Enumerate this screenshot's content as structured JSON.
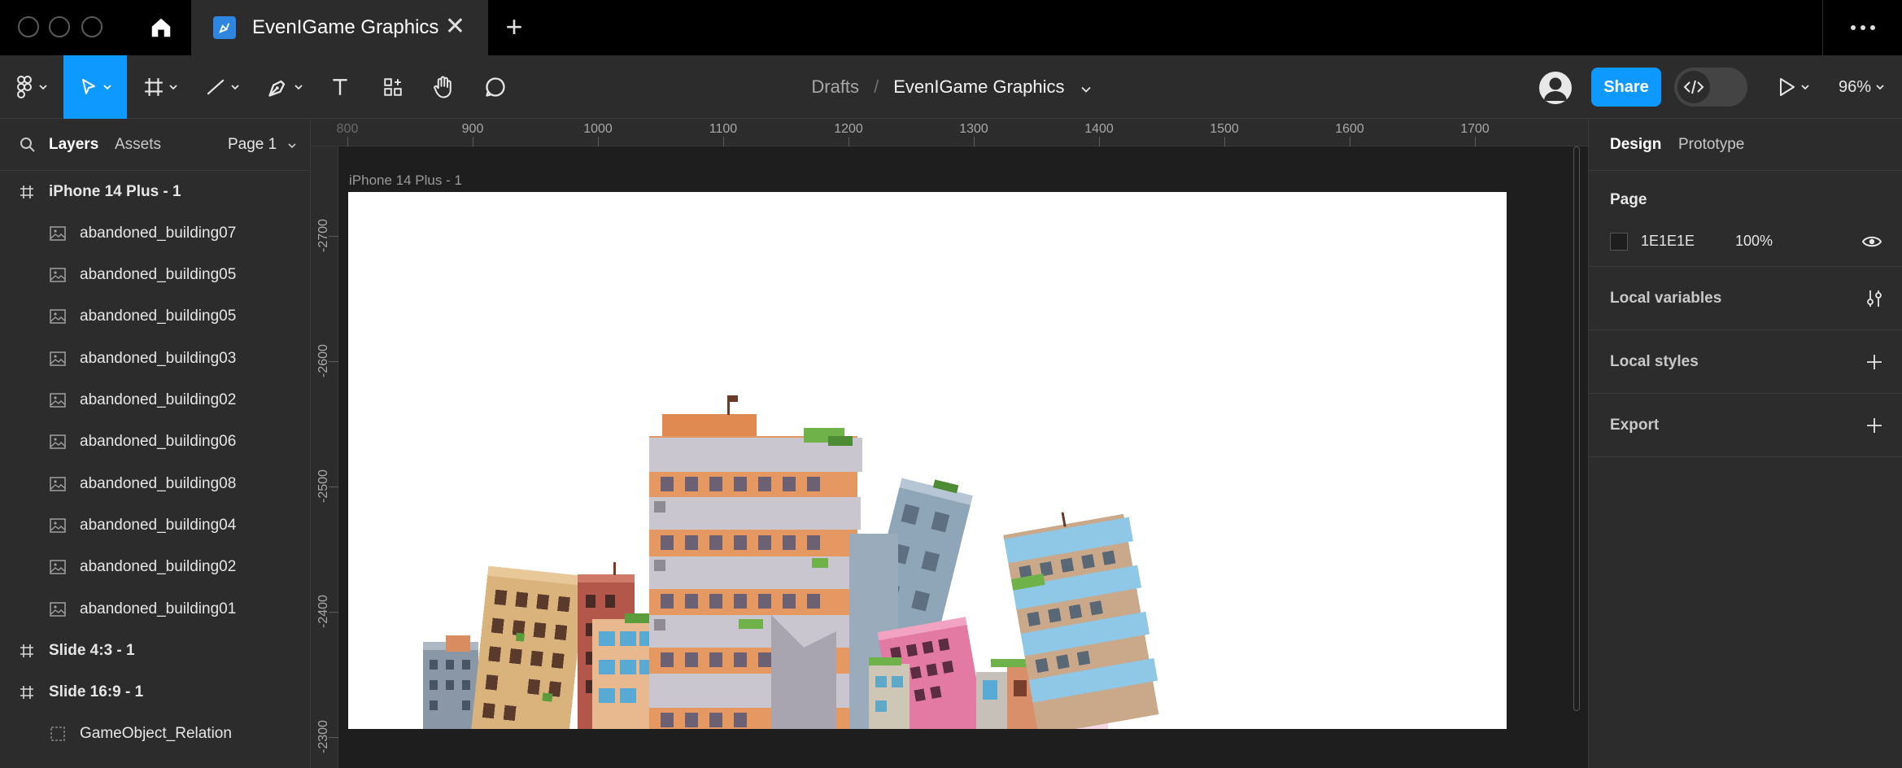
{
  "titlebar": {
    "tab_title": "EvenIGame Graphics",
    "close_glyph": "✕",
    "new_tab_glyph": "+"
  },
  "toolbar": {
    "breadcrumb_root": "Drafts",
    "breadcrumb_sep": "/",
    "file_name": "EvenIGame Graphics",
    "share_label": "Share",
    "zoom": "96%",
    "icons": [
      "figma-menu-icon",
      "move-tool-icon",
      "frame-tool-icon",
      "line-tool-icon",
      "pen-tool-icon",
      "text-tool-icon",
      "components-icon",
      "hand-tool-icon",
      "comment-icon"
    ]
  },
  "left_panel": {
    "tab_layers": "Layers",
    "tab_assets": "Assets",
    "page_selector": "Page 1",
    "layers": [
      {
        "name": "iPhone 14 Plus - 1",
        "type": "frame"
      },
      {
        "name": "abandoned_building07",
        "type": "image"
      },
      {
        "name": "abandoned_building05",
        "type": "image"
      },
      {
        "name": "abandoned_building05",
        "type": "image"
      },
      {
        "name": "abandoned_building03",
        "type": "image"
      },
      {
        "name": "abandoned_building02",
        "type": "image"
      },
      {
        "name": "abandoned_building06",
        "type": "image"
      },
      {
        "name": "abandoned_building08",
        "type": "image"
      },
      {
        "name": "abandoned_building04",
        "type": "image"
      },
      {
        "name": "abandoned_building02",
        "type": "image"
      },
      {
        "name": "abandoned_building01",
        "type": "image"
      },
      {
        "name": "Slide 4:3 - 1",
        "type": "frame"
      },
      {
        "name": "Slide 16:9 - 1",
        "type": "frame"
      },
      {
        "name": "GameObject_Relation",
        "type": "section"
      }
    ]
  },
  "canvas": {
    "frame_label": "iPhone 14 Plus - 1",
    "ruler_x": [
      "800",
      "900",
      "1000",
      "1100",
      "1200",
      "1300",
      "1400",
      "1500",
      "1600",
      "1700"
    ],
    "ruler_y": [
      "-2700",
      "-2600",
      "-2500",
      "-2400",
      "-2300"
    ]
  },
  "right_panel": {
    "tab_design": "Design",
    "tab_prototype": "Prototype",
    "page_heading": "Page",
    "page_color_hex": "1E1E1E",
    "page_color": "#1E1E1E",
    "page_opacity": "100%",
    "local_variables": "Local variables",
    "local_styles": "Local styles",
    "export": "Export"
  },
  "colors": {
    "accent": "#0d99ff",
    "panel": "#2c2c2c",
    "canvas": "#1e1e1e"
  }
}
